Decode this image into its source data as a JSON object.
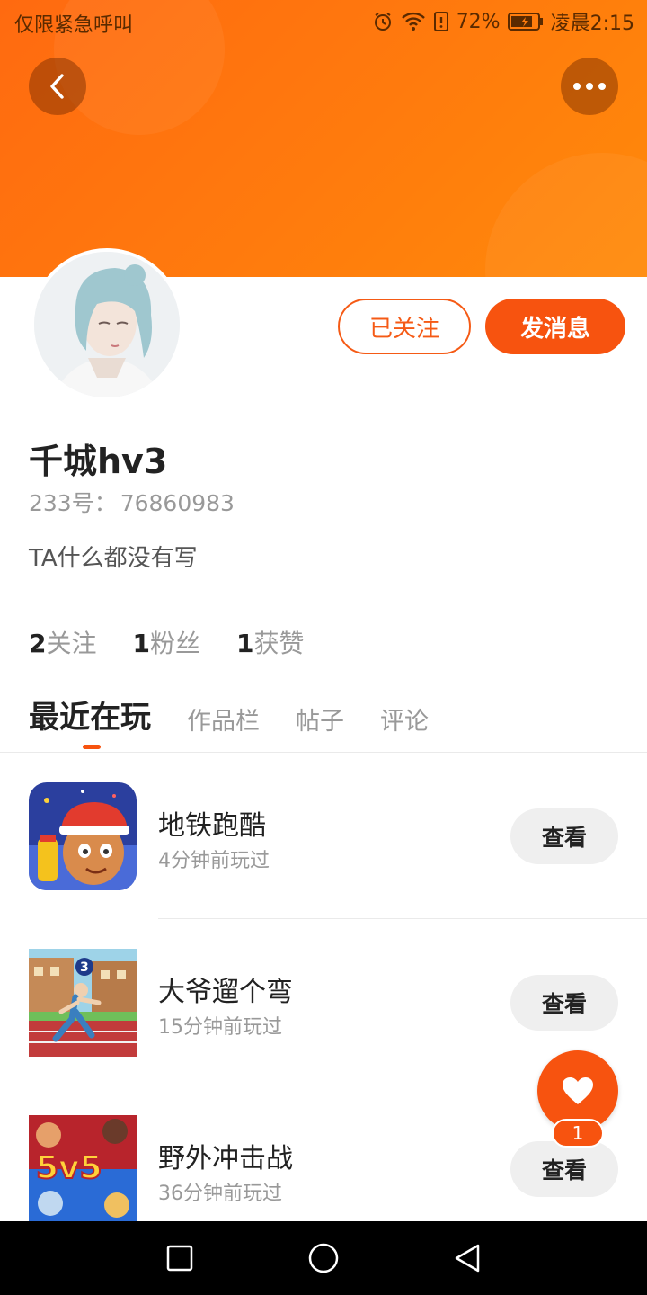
{
  "status_bar": {
    "left_text": "仅限紧急呼叫",
    "battery": "72%",
    "time": "凌晨2:15",
    "icons": [
      "alarm-icon",
      "wifi-icon",
      "sim-alert-icon",
      "battery-icon"
    ]
  },
  "header": {
    "back_icon": "back-arrow-icon",
    "more_icon": "more-dots-icon",
    "banner_color": "#ff7010"
  },
  "profile": {
    "follow_label": "已关注",
    "message_label": "发消息",
    "username": "千城hv3",
    "id_label": "233号：",
    "id_value": "76860983",
    "bio": "TA什么都没有写"
  },
  "stats": [
    {
      "count": "2",
      "label": "关注"
    },
    {
      "count": "1",
      "label": "粉丝"
    },
    {
      "count": "1",
      "label": "获赞"
    }
  ],
  "tabs": [
    {
      "label": "最近在玩",
      "active": true
    },
    {
      "label": "作品栏",
      "active": false
    },
    {
      "label": "帖子",
      "active": false
    },
    {
      "label": "评论",
      "active": false
    }
  ],
  "games": [
    {
      "title": "地铁跑酷",
      "time": "4分钟前玩过",
      "button": "查看"
    },
    {
      "title": "大爷遛个弯",
      "time": "15分钟前玩过",
      "button": "查看"
    },
    {
      "title": "野外冲击战",
      "time": "36分钟前玩过",
      "button": "查看"
    }
  ],
  "game_icon_texts": {
    "runner_number": "3",
    "battle_logo": "5v5"
  },
  "like": {
    "icon": "heart-icon",
    "count": "1"
  },
  "nav": {
    "recent_icon": "square-icon",
    "home_icon": "circle-icon",
    "back_icon": "triangle-back-icon"
  },
  "colors": {
    "accent": "#f7530f",
    "banner": "#ff7010"
  }
}
